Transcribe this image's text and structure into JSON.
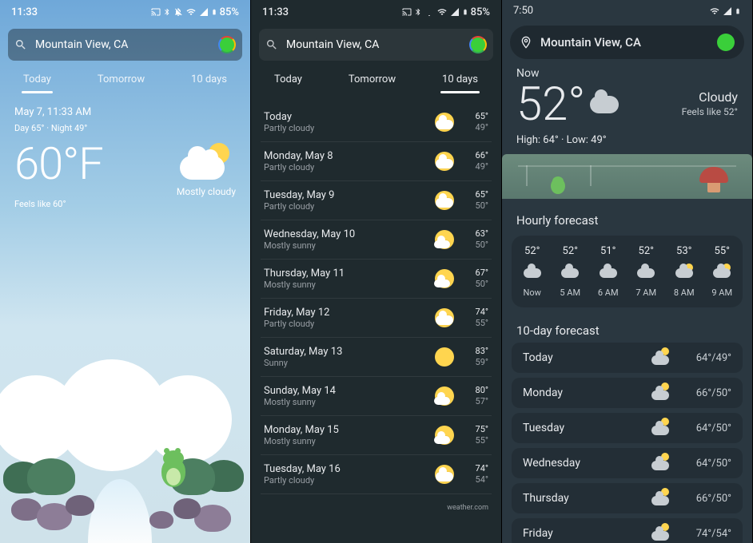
{
  "screen1": {
    "status": {
      "time": "11:33",
      "battery": "85%"
    },
    "search": {
      "location": "Mountain View, CA"
    },
    "tabs": {
      "today": "Today",
      "tomorrow": "Tomorrow",
      "tenday": "10 days",
      "active": "today"
    },
    "date": "May 7, 11:33 AM",
    "hilo": "Day 65° · Night 49°",
    "temp": "60°F",
    "feels": "Feels like 60°",
    "condition": "Mostly cloudy"
  },
  "screen2": {
    "status": {
      "time": "11:33",
      "battery": "85%"
    },
    "search": {
      "location": "Mountain View, CA"
    },
    "tabs": {
      "today": "Today",
      "tomorrow": "Tomorrow",
      "tenday": "10 days",
      "active": "tenday"
    },
    "days": [
      {
        "name": "Today",
        "cond": "Partly cloudy",
        "icon": "partly",
        "hi": "65°",
        "lo": "49°"
      },
      {
        "name": "Monday, May 8",
        "cond": "Partly cloudy",
        "icon": "partly",
        "hi": "66°",
        "lo": "49°"
      },
      {
        "name": "Tuesday, May 9",
        "cond": "Partly cloudy",
        "icon": "partly",
        "hi": "65°",
        "lo": "50°"
      },
      {
        "name": "Wednesday, May 10",
        "cond": "Mostly sunny",
        "icon": "mostly_sunny",
        "hi": "63°",
        "lo": "50°"
      },
      {
        "name": "Thursday, May 11",
        "cond": "Mostly sunny",
        "icon": "mostly_sunny",
        "hi": "67°",
        "lo": "50°"
      },
      {
        "name": "Friday, May 12",
        "cond": "Partly cloudy",
        "icon": "partly",
        "hi": "74°",
        "lo": "55°"
      },
      {
        "name": "Saturday, May 13",
        "cond": "Sunny",
        "icon": "sunny",
        "hi": "83°",
        "lo": "59°"
      },
      {
        "name": "Sunday, May 14",
        "cond": "Mostly sunny",
        "icon": "mostly_sunny",
        "hi": "80°",
        "lo": "57°"
      },
      {
        "name": "Monday, May 15",
        "cond": "Mostly sunny",
        "icon": "mostly_sunny",
        "hi": "75°",
        "lo": "55°"
      },
      {
        "name": "Tuesday, May 16",
        "cond": "Partly cloudy",
        "icon": "partly",
        "hi": "74°",
        "lo": "54°"
      }
    ],
    "attribution": "weather.com"
  },
  "screen3": {
    "status": {
      "time": "7:50"
    },
    "location": "Mountain View, CA",
    "now_label": "Now",
    "temp": "52°",
    "condition": "Cloudy",
    "feels": "Feels like 52°",
    "hilo": "High: 64° · Low: 49°",
    "hourly_title": "Hourly forecast",
    "hourly": [
      {
        "temp": "52°",
        "label": "Now",
        "icon": "cloud"
      },
      {
        "temp": "52°",
        "label": "5 AM",
        "icon": "cloud"
      },
      {
        "temp": "51°",
        "label": "6 AM",
        "icon": "cloud"
      },
      {
        "temp": "52°",
        "label": "7 AM",
        "icon": "cloud"
      },
      {
        "temp": "53°",
        "label": "8 AM",
        "icon": "partly"
      },
      {
        "temp": "55°",
        "label": "9 AM",
        "icon": "partly"
      }
    ],
    "tenday_title": "10-day forecast",
    "tenday": [
      {
        "name": "Today",
        "temps": "64°/49°",
        "icon": "partly"
      },
      {
        "name": "Monday",
        "temps": "66°/50°",
        "icon": "partly"
      },
      {
        "name": "Tuesday",
        "temps": "64°/50°",
        "icon": "partly"
      },
      {
        "name": "Wednesday",
        "temps": "64°/50°",
        "icon": "partly"
      },
      {
        "name": "Thursday",
        "temps": "66°/50°",
        "icon": "partly"
      },
      {
        "name": "Friday",
        "temps": "74°/54°",
        "icon": "partly"
      }
    ]
  }
}
